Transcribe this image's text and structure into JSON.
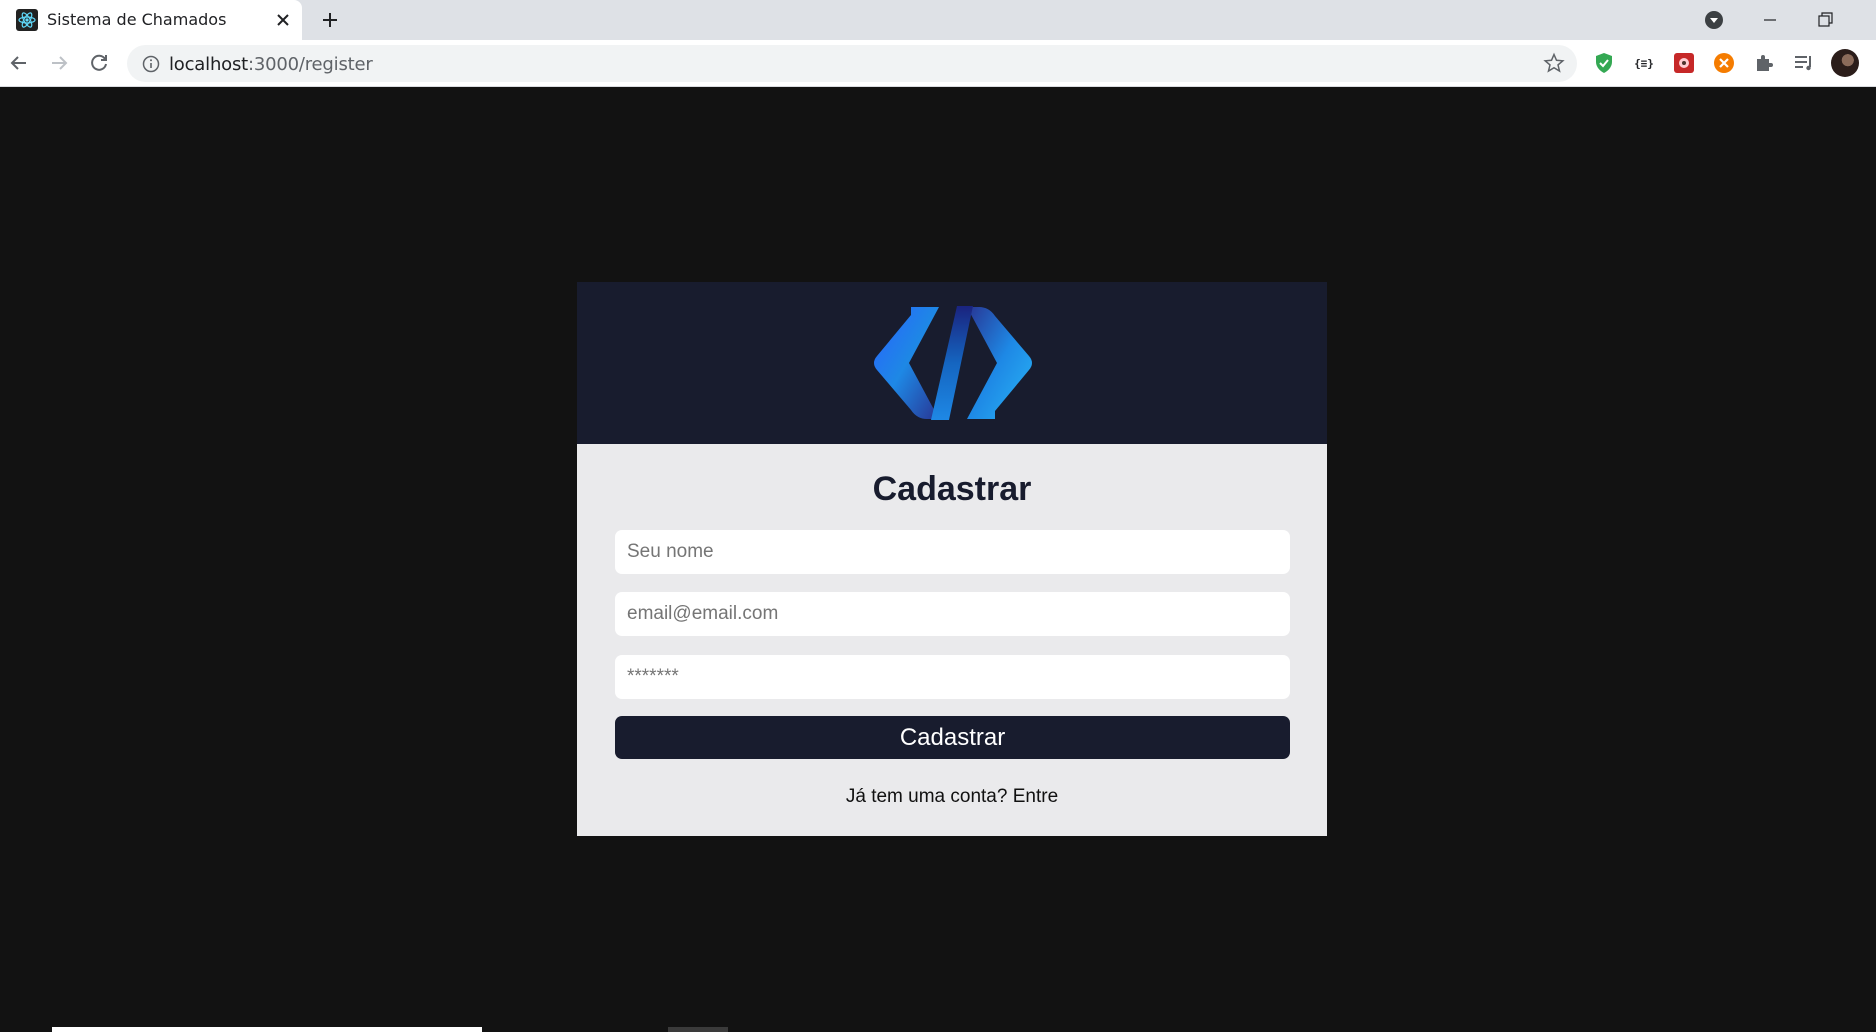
{
  "browser": {
    "tab_title": "Sistema de Chamados",
    "url_host": "localhost",
    "url_path": ":3000/register"
  },
  "header": {
    "logo_colors": [
      "#1e88e5",
      "#283593"
    ]
  },
  "form": {
    "title": "Cadastrar",
    "name_placeholder": "Seu nome",
    "email_placeholder": "email@email.com",
    "password_placeholder": "*******",
    "submit_label": "Cadastrar",
    "login_link": "Já tem uma conta? Entre"
  },
  "colors": {
    "page_background": "#121212",
    "header_background": "#181c2e",
    "card_background": "#eaeaec",
    "button_background": "#181c2e"
  }
}
